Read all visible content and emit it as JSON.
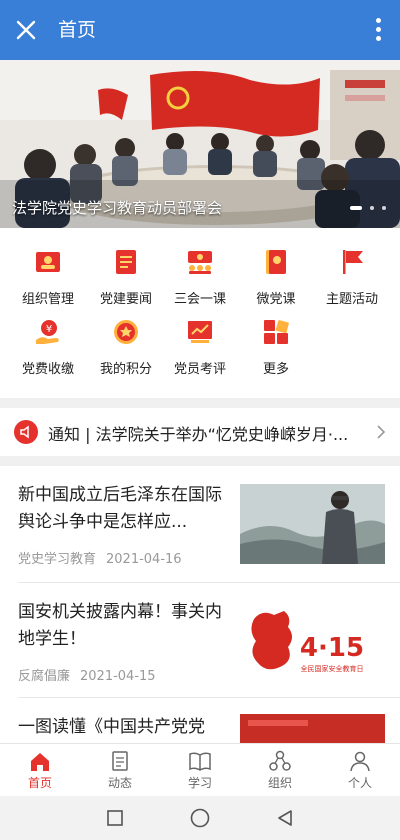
{
  "colors": {
    "primary": "#3a7fd7",
    "accent": "#e5322d",
    "muted": "#999999"
  },
  "header": {
    "title": "首页",
    "close_icon": "close-icon",
    "more_icon": "more-vertical-icon"
  },
  "banner": {
    "caption": "法学院党史学习教育动员部署会"
  },
  "grid": [
    {
      "label": "组织管理",
      "icon": "organization-icon"
    },
    {
      "label": "党建要闻",
      "icon": "news-icon"
    },
    {
      "label": "三会一课",
      "icon": "meeting-icon"
    },
    {
      "label": "微党课",
      "icon": "micro-course-icon"
    },
    {
      "label": "主题活动",
      "icon": "flag-icon"
    },
    {
      "label": "党费收缴",
      "icon": "fee-icon"
    },
    {
      "label": "我的积分",
      "icon": "points-icon"
    },
    {
      "label": "党员考评",
      "icon": "evaluation-icon"
    },
    {
      "label": "更多",
      "icon": "more-apps-icon"
    }
  ],
  "notice": {
    "text": "通知 | 法学院关于举办“忆党史峥嵘岁月·..."
  },
  "news": [
    {
      "title": "新中国成立后毛泽东在国际舆论斗争中是怎样应...",
      "tag": "党史学习教育",
      "date": "2021-04-16"
    },
    {
      "title": "国安机关披露内幕！事关内地学生！",
      "tag": "反腐倡廉",
      "date": "2021-04-15",
      "thumb_text": "4·15",
      "thumb_sub": "全民国家安全教育日"
    },
    {
      "title": "一图读懂《中国共产党党",
      "tag": "",
      "date": ""
    }
  ],
  "tabs": [
    {
      "label": "首页",
      "icon": "home-icon",
      "active": true
    },
    {
      "label": "动态",
      "icon": "document-icon",
      "active": false
    },
    {
      "label": "学习",
      "icon": "book-icon",
      "active": false
    },
    {
      "label": "组织",
      "icon": "organization-nodes-icon",
      "active": false
    },
    {
      "label": "个人",
      "icon": "person-icon",
      "active": false
    }
  ]
}
